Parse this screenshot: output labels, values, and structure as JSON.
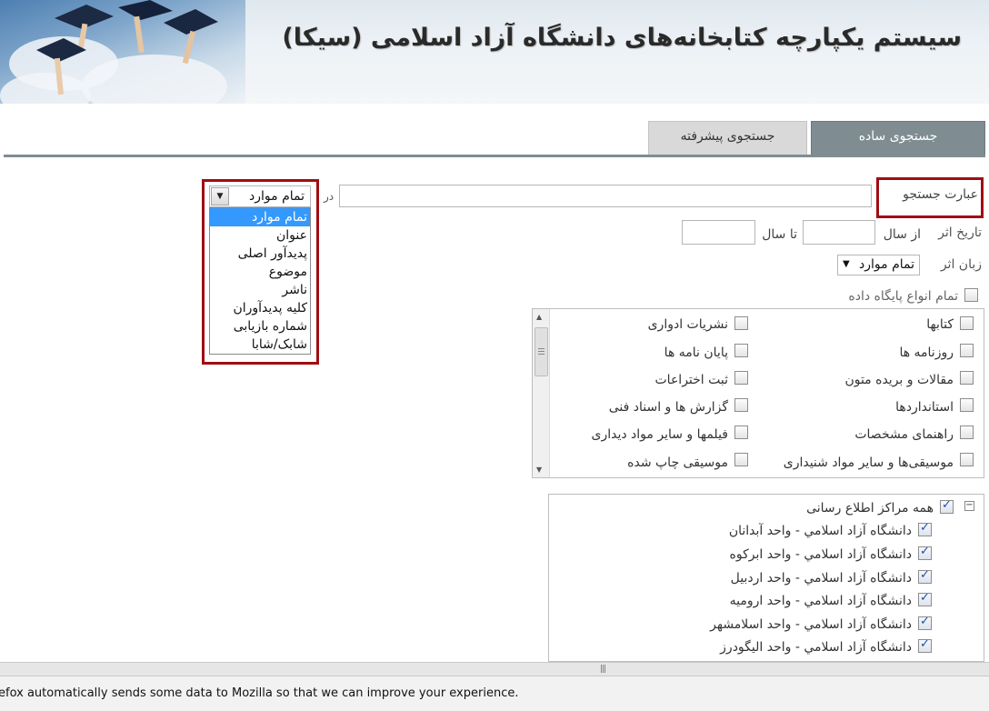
{
  "header": {
    "title": "سیستم یکپارچه کتابخانه‌های دانشگاه آزاد اسلامی (سیکا)"
  },
  "tabs": {
    "simple": "جستجوی ساده",
    "advanced": "جستجوی پیشرفته"
  },
  "search": {
    "label": "عبارت جستجو",
    "input_value": "",
    "in_label": "در",
    "field_selected": "تمام موارد",
    "field_options": [
      "تمام موارد",
      "عنوان",
      "پدیدآور اصلی",
      "موضوع",
      "ناشر",
      "کلیه پدیدآوران",
      "شماره بازیابی",
      "شابک/شابا"
    ]
  },
  "date": {
    "label": "تاریخ اثر",
    "from_label": "از سال",
    "to_label": "تا سال",
    "from_value": "",
    "to_value": ""
  },
  "language": {
    "label": "زبان اثر",
    "selected": "تمام موارد"
  },
  "db_types": {
    "all_label": "تمام انواع پایگاه داده",
    "items": [
      {
        "label": "کتابها",
        "checked": false
      },
      {
        "label": "نشریات ادواری",
        "checked": false
      },
      {
        "label": "روزنامه ها",
        "checked": false
      },
      {
        "label": "پایان نامه ها",
        "checked": false
      },
      {
        "label": "مقالات و بریده متون",
        "checked": false
      },
      {
        "label": "ثبت اختراعات",
        "checked": false
      },
      {
        "label": "استانداردها",
        "checked": false
      },
      {
        "label": "گزارش ها و اسناد فنی",
        "checked": false
      },
      {
        "label": "راهنمای مشخصات",
        "checked": false
      },
      {
        "label": "فیلمها و سایر مواد دیداری",
        "checked": false
      },
      {
        "label": "موسیقی‌ها و سایر مواد شنیداری",
        "checked": false
      },
      {
        "label": "موسیقی چاپ شده",
        "checked": false
      }
    ]
  },
  "centers": {
    "all_label": "همه مراکز اطلاع رسانی",
    "toggle": "−",
    "items": [
      "دانشگاه آزاد اسلامي - واحد آبدانان",
      "دانشگاه آزاد اسلامي - واحد ابركوه",
      "دانشگاه آزاد اسلامي - واحد اردبيل",
      "دانشگاه آزاد اسلامي - واحد اروميه",
      "دانشگاه آزاد اسلامي - واحد اسلامشهر",
      "دانشگاه آزاد اسلامي - واحد اليگودرز"
    ]
  },
  "notice": {
    "text": "efox automatically sends some data to Mozilla so that we can improve your experience."
  },
  "colors": {
    "highlight_border": "#a10d13",
    "tab_active": "#7f8d92",
    "tab_inactive": "#d9d9d9",
    "selection": "#3399ff"
  }
}
